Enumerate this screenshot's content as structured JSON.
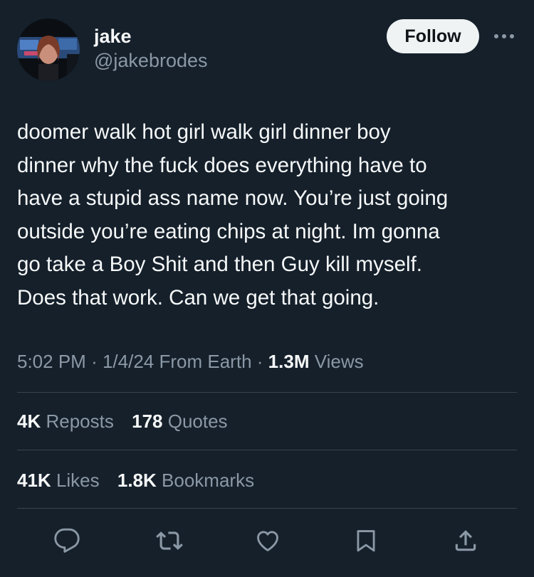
{
  "author": {
    "display_name": "jake",
    "handle": "@jakebrodes",
    "follow_label": "Follow"
  },
  "tweet": {
    "text": "doomer walk hot girl walk girl dinner boy\ndinner why the fuck does everything have to\nhave a stupid ass name now. You’re just going\noutside you’re eating chips at night. Im gonna\ngo take a Boy Shit and then Guy kill myself.\nDoes that work. Can we get that going.",
    "time": "5:02 PM",
    "separator": "·",
    "date": "1/4/24",
    "source": "From Earth",
    "views_count": "1.3M",
    "views_label": "Views"
  },
  "stats": {
    "reposts_count": "4K",
    "reposts_label": "Reposts",
    "quotes_count": "178",
    "quotes_label": "Quotes",
    "likes_count": "41K",
    "likes_label": "Likes",
    "bookmarks_count": "1.8K",
    "bookmarks_label": "Bookmarks"
  },
  "actions": [
    {
      "icon": "reply-icon"
    },
    {
      "icon": "repost-icon"
    },
    {
      "icon": "like-icon"
    },
    {
      "icon": "bookmark-icon"
    },
    {
      "icon": "share-icon"
    }
  ],
  "colors": {
    "background": "#15202b",
    "text_primary": "#f7f9f9",
    "text_secondary": "#8b98a5",
    "divider": "#38444d",
    "follow_button_bg": "#eff3f4"
  }
}
